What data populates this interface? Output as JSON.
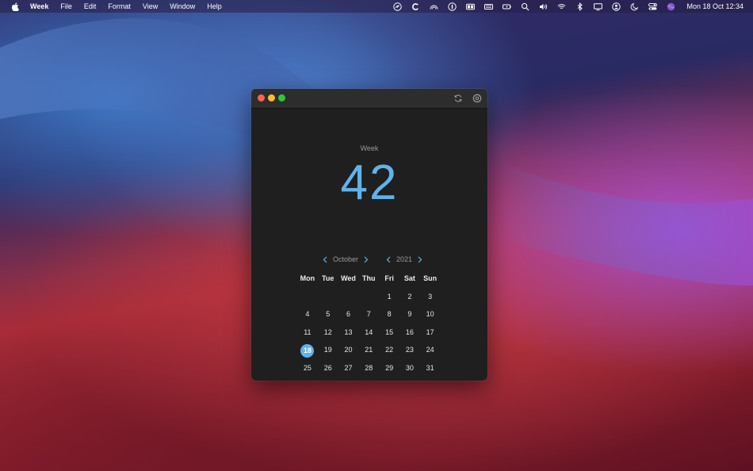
{
  "menubar": {
    "app_name": "Week",
    "items": [
      "File",
      "Edit",
      "Format",
      "View",
      "Window",
      "Help"
    ],
    "tray_icons": [
      "scribble-icon",
      "c-icon",
      "rainbow-icon",
      "one-password-icon",
      "window-icon",
      "keyboard-icon",
      "battery-icon",
      "search-icon",
      "volume-icon",
      "wifi-icon",
      "bluetooth-icon",
      "display-icon",
      "user-icon",
      "moon-icon",
      "control-center-icon",
      "siri-icon"
    ],
    "clock": "Mon 18 Oct  12:34"
  },
  "window": {
    "week_label": "Week",
    "week_number": "42",
    "month": "October",
    "year": "2021",
    "weekdays": [
      "Mon",
      "Tue",
      "Wed",
      "Thu",
      "Fri",
      "Sat",
      "Sun"
    ],
    "days": [
      [
        "",
        "",
        "",
        "",
        "1",
        "2",
        "3"
      ],
      [
        "4",
        "5",
        "6",
        "7",
        "8",
        "9",
        "10"
      ],
      [
        "11",
        "12",
        "13",
        "14",
        "15",
        "16",
        "17"
      ],
      [
        "18",
        "19",
        "20",
        "21",
        "22",
        "23",
        "24"
      ],
      [
        "25",
        "26",
        "27",
        "28",
        "29",
        "30",
        "31"
      ]
    ],
    "today": "18",
    "accent_color": "#5fb3ec"
  }
}
